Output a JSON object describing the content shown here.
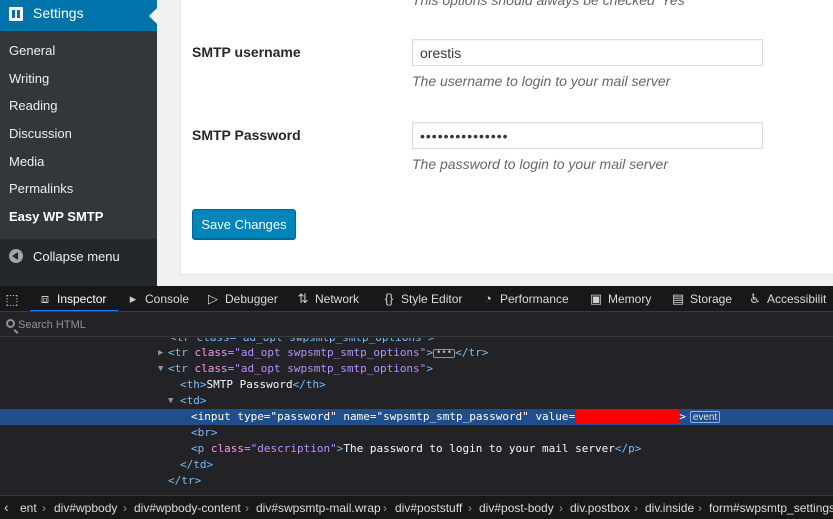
{
  "wp": {
    "sidebar": {
      "section_title": "Settings",
      "items": [
        {
          "label": "General"
        },
        {
          "label": "Writing"
        },
        {
          "label": "Reading"
        },
        {
          "label": "Discussion"
        },
        {
          "label": "Media"
        },
        {
          "label": "Permalinks"
        },
        {
          "label": "Easy WP SMTP"
        }
      ],
      "collapse_label": "Collapse menu"
    },
    "form": {
      "top_desc": "This options should always be checked 'Yes'",
      "username_label": "SMTP username",
      "username_value": "orestis",
      "username_desc": "The username to login to your mail server",
      "password_label": "SMTP Password",
      "password_value": "•••••••••••••••",
      "password_desc": "The password to login to your mail server",
      "save_label": "Save Changes"
    }
  },
  "devtools": {
    "tabs": [
      {
        "label": "Inspector",
        "icon": "inspector-icon"
      },
      {
        "label": "Console",
        "icon": "console-icon"
      },
      {
        "label": "Debugger",
        "icon": "debugger-icon"
      },
      {
        "label": "Network",
        "icon": "network-icon"
      },
      {
        "label": "Style Editor",
        "icon": "style-editor-icon"
      },
      {
        "label": "Performance",
        "icon": "performance-icon"
      },
      {
        "label": "Memory",
        "icon": "memory-icon"
      },
      {
        "label": "Storage",
        "icon": "storage-icon"
      },
      {
        "label": "Accessibilit",
        "icon": "accessibility-icon"
      }
    ],
    "search_placeholder": "Search HTML",
    "tree": {
      "line0": "<tr class=\"ad_opt swpsmtp_smtp_options\">",
      "line1_tag_open": "<tr",
      "line1_attr": "class",
      "line1_val": "\"ad_opt swpsmtp_smtp_options\"",
      "line1_close": "</tr>",
      "line2_tag_open": "<tr",
      "line2_attr": "class",
      "line2_val": "\"ad_opt swpsmtp_smtp_options\"",
      "line3_th_open": "<th>",
      "line3_text": "SMTP Password",
      "line3_th_close": "</th>",
      "line4_td": "<td>",
      "line5_input": "<input",
      "line5_type_attr": "type",
      "line5_type_val": "\"password\"",
      "line5_name_attr": "name",
      "line5_name_val": "\"swpsmtp_smtp_password\"",
      "line5_value_attr": "value",
      "line5_event": "event",
      "line6_br": "<br>",
      "line7_p": "<p",
      "line7_class_attr": "class",
      "line7_class_val": "\"description\"",
      "line7_text": "The password to login to your mail server",
      "line7_p_close": "</p>",
      "line8_td_close": "</td>",
      "line9_tr_close": "</tr>"
    },
    "breadcrumbs": [
      "ent",
      "div#wpbody",
      "div#wpbody-content",
      "div#swpsmtp-mail.wrap",
      "div#poststuff",
      "div#post-body",
      "div.postbox",
      "div.inside",
      "form#swpsmtp_settings_"
    ]
  },
  "colors": {
    "wp_accent": "#0073aa",
    "button_blue": "#0085ba",
    "devtools_bg": "#232327",
    "selection": "#204e8a",
    "redaction": "#ff0000"
  }
}
